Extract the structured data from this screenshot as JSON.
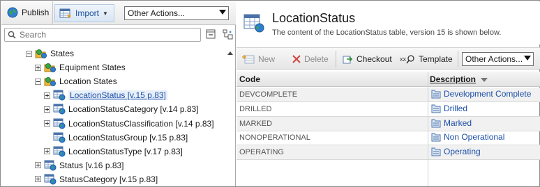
{
  "left_toolbar": {
    "publish_label": "Publish",
    "import_label": "Import",
    "other_actions_value": "Other Actions..."
  },
  "search": {
    "placeholder": "Search"
  },
  "tree": [
    {
      "label": "States",
      "type": "folder-globe",
      "expander": "minus"
    },
    {
      "label": "Equipment States",
      "type": "folder-globe",
      "expander": "plus"
    },
    {
      "label": "Location States",
      "type": "folder-globe",
      "expander": "minus"
    },
    {
      "label": "LocationStatus [v.15 p.83]",
      "type": "table",
      "expander": "plus",
      "selected": true
    },
    {
      "label": "LocationStatusCategory [v.14 p.83]",
      "type": "table",
      "expander": "plus"
    },
    {
      "label": "LocationStatusClassification [v.14 p.83]",
      "type": "table",
      "expander": "plus"
    },
    {
      "label": "LocationStatusGroup [v.15 p.83]",
      "type": "table",
      "expander": "none"
    },
    {
      "label": "LocationStatusType [v.17 p.83]",
      "type": "table",
      "expander": "plus"
    },
    {
      "label": "Status [v.16 p.83]",
      "type": "table",
      "expander": "plus"
    },
    {
      "label": "StatusCategory [v.15 p.83]",
      "type": "table",
      "expander": "plus"
    }
  ],
  "header": {
    "title": "LocationStatus",
    "subtitle": "The content of the LocationStatus table, version 15 is shown below."
  },
  "right_toolbar": {
    "new_label": "New",
    "delete_label": "Delete",
    "checkout_label": "Checkout",
    "template_label": "Template",
    "other_actions_value": "Other Actions..."
  },
  "table": {
    "columns": [
      "Code",
      "Description"
    ],
    "rows": [
      {
        "code": "DEVCOMPLETE",
        "description": "Development Complete"
      },
      {
        "code": "DRILLED",
        "description": "Drilled"
      },
      {
        "code": "MARKED",
        "description": "Marked"
      },
      {
        "code": "NONOPERATIONAL",
        "description": "Non Operational"
      },
      {
        "code": "OPERATING",
        "description": "Operating"
      }
    ]
  },
  "colors": {
    "link": "#1c4fa8",
    "row_alt": "#f1f1f1",
    "toolbar": "#e9e9e9"
  }
}
